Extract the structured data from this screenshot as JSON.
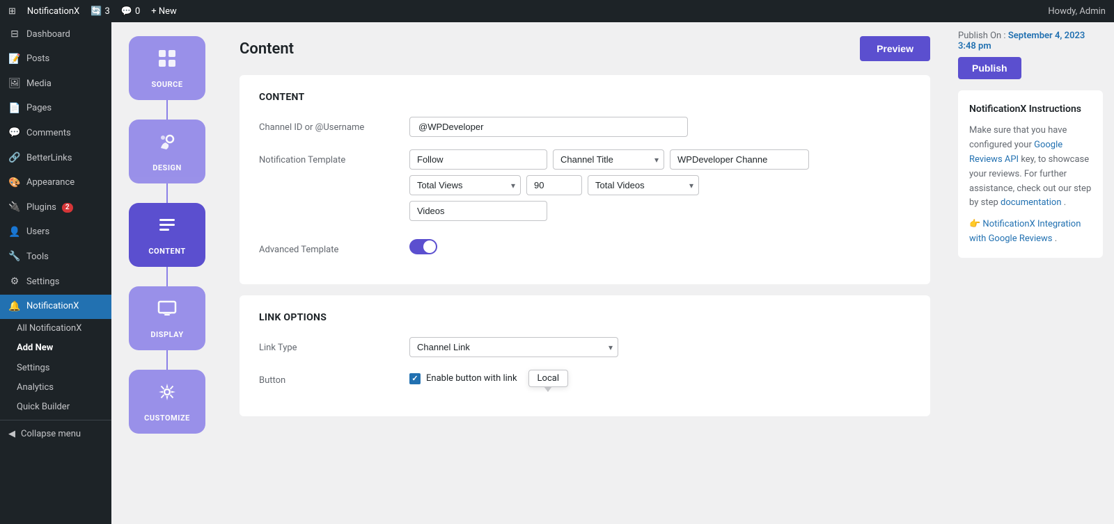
{
  "adminBar": {
    "logo": "⊞",
    "siteName": "NotificationX",
    "updates": "3",
    "comments": "0",
    "newLabel": "+ New",
    "howdy": "Howdy, Admin"
  },
  "sidebar": {
    "items": [
      {
        "id": "dashboard",
        "icon": "⊟",
        "label": "Dashboard"
      },
      {
        "id": "posts",
        "icon": "📝",
        "label": "Posts"
      },
      {
        "id": "media",
        "icon": "🖼",
        "label": "Media"
      },
      {
        "id": "pages",
        "icon": "📄",
        "label": "Pages"
      },
      {
        "id": "comments",
        "icon": "💬",
        "label": "Comments"
      },
      {
        "id": "betterlinks",
        "icon": "🔗",
        "label": "BetterLinks"
      },
      {
        "id": "appearance",
        "icon": "🎨",
        "label": "Appearance"
      },
      {
        "id": "plugins",
        "icon": "🔌",
        "label": "Plugins",
        "badge": "2"
      },
      {
        "id": "users",
        "icon": "👤",
        "label": "Users"
      },
      {
        "id": "tools",
        "icon": "🔧",
        "label": "Tools"
      },
      {
        "id": "settings",
        "icon": "⚙",
        "label": "Settings"
      },
      {
        "id": "notificationx",
        "icon": "🔔",
        "label": "NotificationX",
        "active": true
      }
    ],
    "submenu": [
      {
        "id": "all",
        "label": "All NotificationX"
      },
      {
        "id": "addnew",
        "label": "Add New",
        "activeStyle": true
      },
      {
        "id": "settings2",
        "label": "Settings"
      },
      {
        "id": "analytics",
        "label": "Analytics"
      },
      {
        "id": "quickbuilder",
        "label": "Quick Builder"
      }
    ],
    "collapse": "Collapse menu"
  },
  "steps": [
    {
      "id": "source",
      "label": "SOURCE",
      "icon": "⧉",
      "active": false
    },
    {
      "id": "design",
      "label": "DESIGN",
      "icon": "✦",
      "active": false
    },
    {
      "id": "content",
      "label": "CONTENT",
      "icon": "☰",
      "active": true
    },
    {
      "id": "display",
      "label": "DISPLAY",
      "icon": "🖥",
      "active": false
    },
    {
      "id": "customize",
      "label": "CUSTOMIZE",
      "icon": "⚙",
      "active": false
    }
  ],
  "header": {
    "title": "Content",
    "previewLabel": "Preview"
  },
  "content": {
    "sectionTitle": "CONTENT",
    "channelIdLabel": "Channel ID or @Username",
    "channelIdValue": "@WPDeveloper",
    "notificationTemplateLabel": "Notification Template",
    "template": {
      "followLabel": "Follow",
      "channelTitleLabel": "Channel Title",
      "channelTitleValue": "WPDeveloper Channe",
      "totalViewsLabel": "Total Views",
      "totalViewsNumber": "90",
      "totalVideosLabel": "Total Videos",
      "videosLabel": "Videos"
    },
    "advancedTemplateLabel": "Advanced Template",
    "advancedTemplateEnabled": true
  },
  "linkOptions": {
    "sectionTitle": "LINK OPTIONS",
    "linkTypeLabel": "Link Type",
    "linkTypeValue": "Channel Link",
    "buttonLabel": "Button",
    "enableButtonLabel": "Enable button with link",
    "localTooltip": "Local"
  },
  "publishSection": {
    "publishOnLabel": "Publish On :",
    "publishDate": "September 4, 2023 3:48 pm",
    "publishButtonLabel": "Publish"
  },
  "instructions": {
    "title": "NotificationX Instructions",
    "body1": "Make sure that you have configured your",
    "googleLink": "Google Reviews API",
    "body2": "key, to showcase your reviews. For further assistance, check out our step by step",
    "docLink": "documentation",
    "body3": ".",
    "emoji": "👉",
    "integrationText": "NotificationX",
    "integrationLink": "Integration with Google Reviews",
    "period": "."
  }
}
